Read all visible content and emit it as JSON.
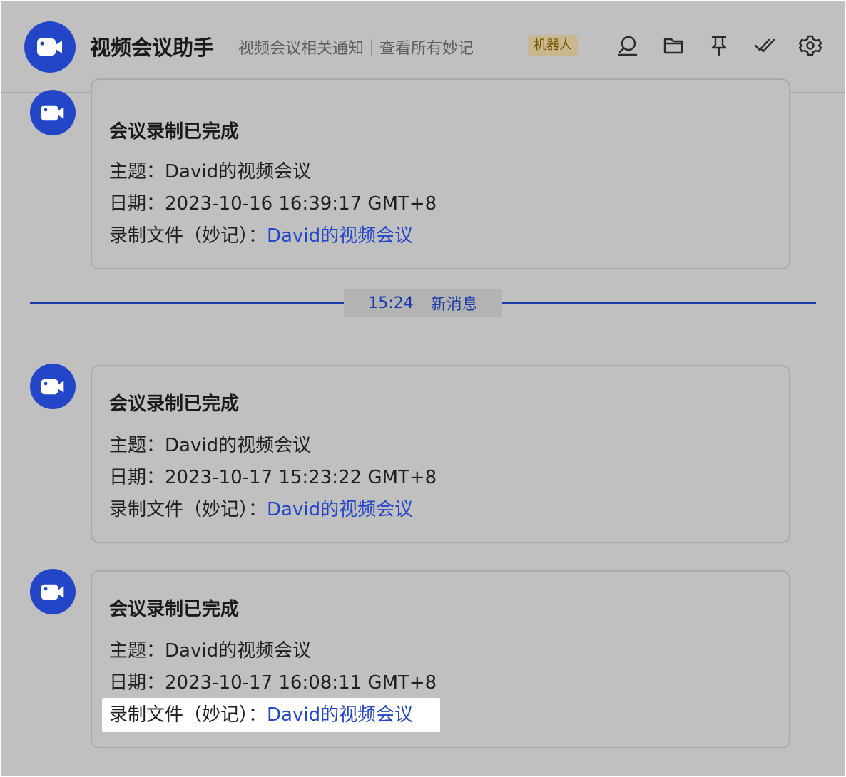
{
  "header": {
    "title": "视频会议助手",
    "description": "视频会议相关通知｜查看所有妙记",
    "badge": "机器人",
    "icons": [
      "search-icon",
      "folder-icon",
      "pin-icon",
      "mark-read-icon",
      "settings-icon"
    ]
  },
  "messages": [
    {
      "title": "会议录制已完成",
      "topic_label": "主题：",
      "topic_value": "David的视频会议",
      "date_label": "日期：",
      "date_value": "2023-10-16 16:39:17 GMT+8",
      "file_label": "录制文件（妙记）：",
      "file_link": "David的视频会议"
    },
    {
      "title": "会议录制已完成",
      "topic_label": "主题：",
      "topic_value": "David的视频会议",
      "date_label": "日期：",
      "date_value": "2023-10-17 15:23:22 GMT+8",
      "file_label": "录制文件（妙记）：",
      "file_link": "David的视频会议"
    },
    {
      "title": "会议录制已完成",
      "topic_label": "主题：",
      "topic_value": "David的视频会议",
      "date_label": "日期：",
      "date_value": "2023-10-17 16:08:11 GMT+8",
      "file_label": "录制文件（妙记）：",
      "file_link": "David的视频会议"
    }
  ],
  "divider": {
    "time": "15:24",
    "label": "新消息"
  },
  "colors": {
    "accent": "#2346c8",
    "overlay": "#c0c0c0",
    "divider": "#1d3aa8",
    "badge_bg": "#c9b88f",
    "badge_text": "#7a5500"
  }
}
